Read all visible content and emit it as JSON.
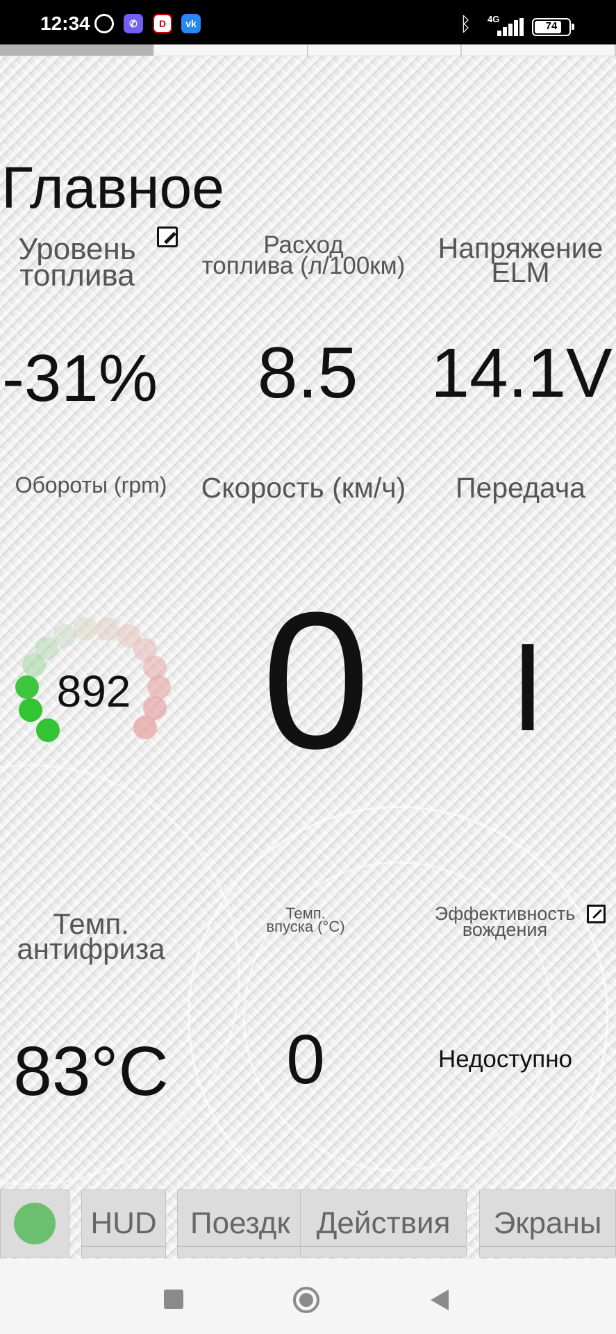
{
  "status_bar": {
    "time": "12:34",
    "network": "4G",
    "battery": "74"
  },
  "page": {
    "title": "Главное"
  },
  "tiles": {
    "fuel_level": {
      "label_line1": "Уровень",
      "label_line2": "топлива",
      "value": "-31%"
    },
    "fuel_consumption": {
      "label_line1": "Расход",
      "label_line2": "топлива (л/100км)",
      "value": "8.5"
    },
    "elm_voltage": {
      "label_line1": "Напряжение",
      "label_line2": "ELM",
      "value": "14.1V"
    },
    "rpm": {
      "label": "Обороты (rpm)",
      "value": "892"
    },
    "speed": {
      "label": "Скорость (км/ч)",
      "value": "0"
    },
    "gear": {
      "label": "Передача",
      "value": "I"
    },
    "coolant_temp": {
      "label_line1": "Темп.",
      "label_line2": "антифриза",
      "value": "83°C"
    },
    "intake_temp": {
      "label_line1": "Темп.",
      "label_line2": "впуска (°C)",
      "value": "0"
    },
    "driving_efficiency": {
      "label_line1": "Эффективность",
      "label_line2": "вождения",
      "value": "Недоступно"
    }
  },
  "bottom_tabs": {
    "hud": "HUD",
    "trips": "Поездк",
    "actions": "Действия",
    "screens": "Экраны"
  },
  "colors": {
    "status_ok": "#6cbf6e",
    "rpm_low": "#33c433",
    "rpm_high": "#e8a0a0"
  },
  "icons": {
    "edit": "edit-icon",
    "external": "external-link-icon",
    "bluetooth": "bluetooth-icon"
  }
}
